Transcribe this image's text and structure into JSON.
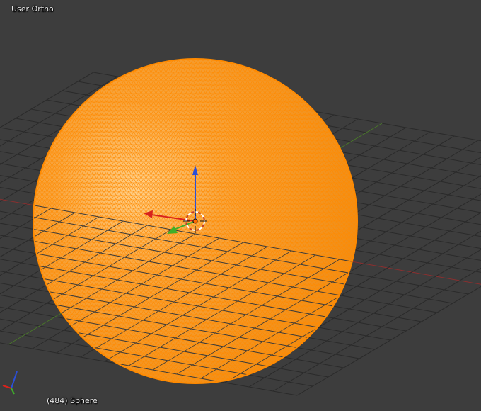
{
  "viewport": {
    "view_name": "User Ortho",
    "frame_and_object": "(484) Sphere",
    "background_color": "#3d3d3d"
  },
  "mesh": {
    "object_type": "uv-sphere",
    "wire_color": "#ff8a00",
    "fill_color": "#f7a23a",
    "highlight_color": "#ffd08a"
  },
  "gizmo": {
    "x_axis_color": "#d8231c",
    "y_axis_color": "#3fae2a",
    "z_axis_color": "#2c4fd6",
    "cursor_icon": "3d-cursor-icon"
  },
  "grid": {
    "line_color": "#2a2a2a",
    "x_axis_line_color": "#8a2f2f",
    "y_axis_line_color": "#4c7a2c"
  }
}
